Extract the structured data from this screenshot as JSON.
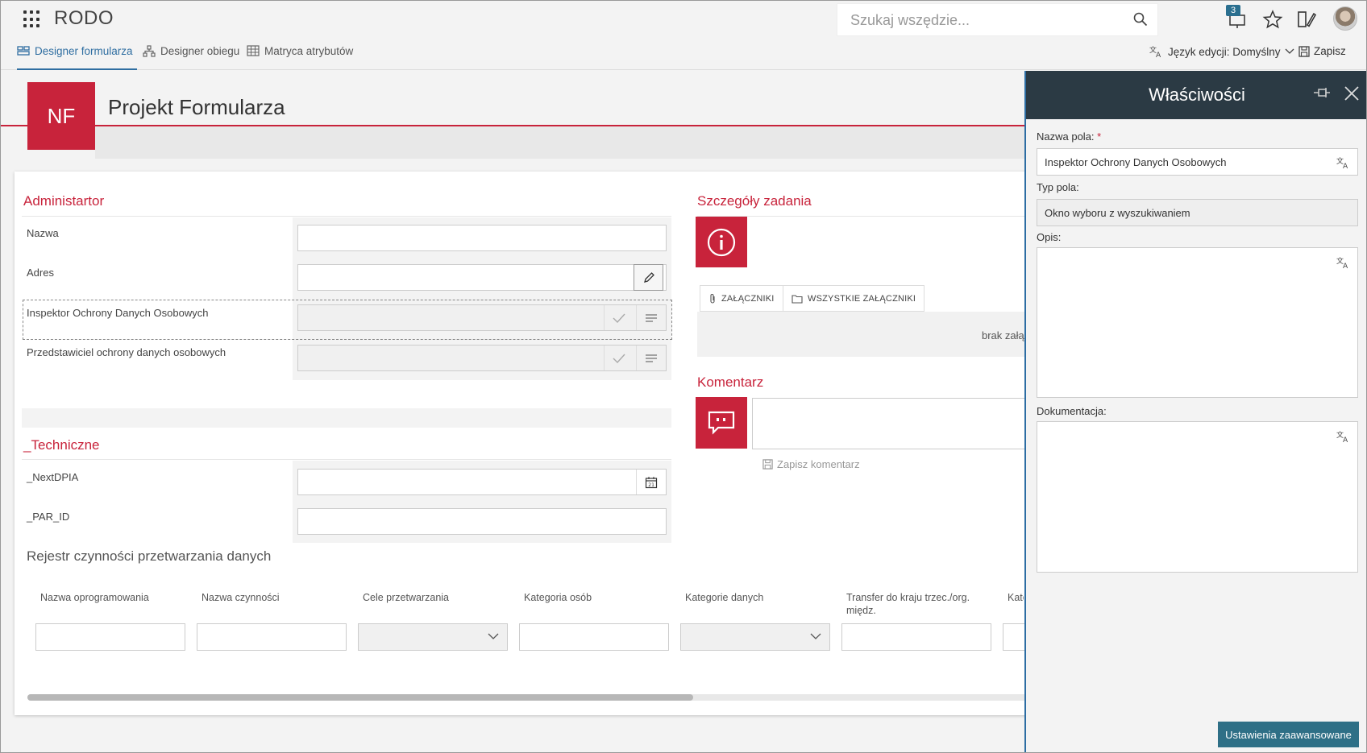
{
  "app": {
    "title": "RODO"
  },
  "search": {
    "placeholder": "Szukaj wszędzie..."
  },
  "topbar": {
    "notifications_count": "3"
  },
  "nav": {
    "tabs": [
      {
        "label": "Designer formularza",
        "icon": "form-layout-icon",
        "active": true
      },
      {
        "label": "Designer obiegu",
        "icon": "workflow-icon",
        "active": false
      },
      {
        "label": "Matryca atrybutów",
        "icon": "matrix-icon",
        "active": false
      }
    ],
    "language_label": "Język edycji: Domyślny",
    "save_label": "Zapisz"
  },
  "header": {
    "tile": "NF",
    "title": "Projekt Formularza"
  },
  "form": {
    "admin_section": "Administartor",
    "fields": [
      {
        "label": "Nazwa"
      },
      {
        "label": "Adres"
      },
      {
        "label": "Inspektor Ochrony Danych Osobowych"
      },
      {
        "label": "Przedstawiciel ochrony danych osobowych"
      }
    ],
    "tech_section": "_Techniczne",
    "tech_fields": [
      {
        "label": "_NextDPIA"
      },
      {
        "label": "_PAR_ID"
      }
    ],
    "register_title": "Rejestr czynności przetwarzania danych",
    "register_columns": [
      "Nazwa oprogramowania",
      "Nazwa czynności",
      "Cele przetwarzania",
      "Kategoria osób",
      "Kategorie danych",
      "Transfer do kraju trzec./org. międz.",
      "Kate"
    ]
  },
  "task": {
    "title": "Szczegóły zadania",
    "attachments_tab": "ZAŁĄCZNIKI",
    "all_attachments_tab": "WSZYSTKIE ZAŁĄCZNIKI",
    "no_attachments": "brak załą",
    "comment_title": "Komentarz",
    "save_comment": "Zapisz komentarz"
  },
  "properties": {
    "title": "Właściwości",
    "field_name_label": "Nazwa pola:",
    "field_name_required": "*",
    "field_name_value": "Inspektor Ochrony Danych Osobowych",
    "field_type_label": "Typ pola:",
    "field_type_value": "Okno wyboru z wyszukiwaniem",
    "description_label": "Opis:",
    "documentation_label": "Dokumentacja:",
    "advanced_button": "Ustawienia zaawansowane"
  },
  "colors": {
    "accent_red": "#c8233b",
    "panel_header": "#2b3a44",
    "link_blue": "#2f6ea1",
    "button_teal": "#2e6f86"
  }
}
